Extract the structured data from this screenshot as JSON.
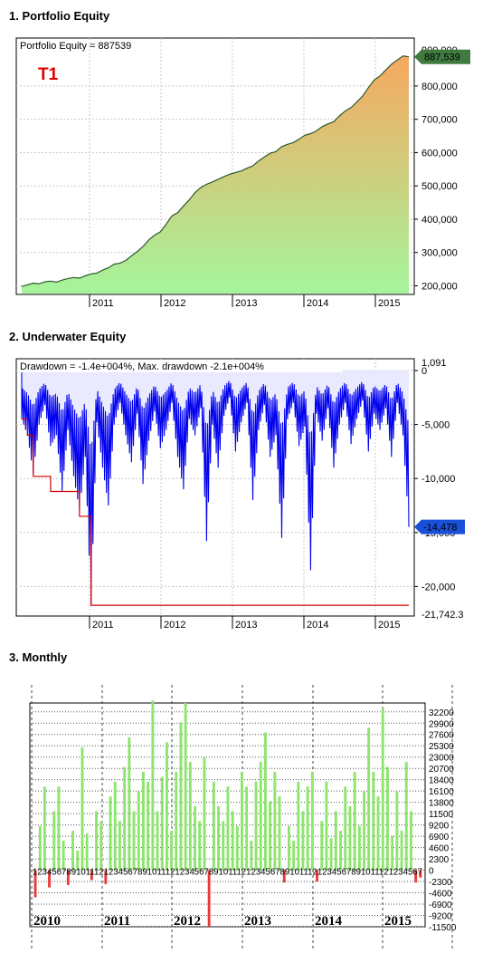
{
  "sections": {
    "s1": "1. Portfolio Equity",
    "s2": "2. Underwater Equity",
    "s3": "3. Monthly"
  },
  "colors": {
    "equity_top": "#f7a860",
    "equity_bottom": "#a4f59c",
    "equity_line": "#2e5a2e",
    "label_green": "#3f7a3f",
    "drawdown_blue": "#0000ee",
    "drawdown_red": "#d40000",
    "bar_pos": "#8ee56e",
    "bar_neg": "#e83a3a"
  },
  "chart_data": [
    {
      "type": "area",
      "title": "Portfolio Equity = 887539",
      "watermark": "T1",
      "series": [
        {
          "name": "Portfolio Equity",
          "values": [
            198000,
            203000,
            208000,
            206000,
            212000,
            214000,
            211000,
            217000,
            222000,
            225000,
            223000,
            230000,
            236000,
            238000,
            247000,
            254000,
            265000,
            268000,
            276000,
            290000,
            303000,
            318000,
            338000,
            352000,
            362000,
            385000,
            410000,
            420000,
            440000,
            458000,
            480000,
            495000,
            505000,
            512000,
            520000,
            528000,
            535000,
            540000,
            545000,
            553000,
            560000,
            575000,
            587000,
            598000,
            603000,
            618000,
            625000,
            630000,
            640000,
            652000,
            657000,
            665000,
            678000,
            686000,
            693000,
            710000,
            725000,
            735000,
            752000,
            770000,
            795000,
            818000,
            830000,
            848000,
            865000,
            878000,
            890000,
            887539
          ]
        }
      ],
      "x_ticks": [
        "2011",
        "2012",
        "2013",
        "2014",
        "2015"
      ],
      "y_ticks": [
        "200,000",
        "300,000",
        "400,000",
        "500,000",
        "600,000",
        "700,000",
        "800,000"
      ],
      "ylim": [
        185000,
        895000
      ],
      "last_value_label": "887,539",
      "top_tick_partial": "900,000"
    },
    {
      "type": "area",
      "title": "Drawdown = -1.4e+004%, Max. drawdown -2.1e+004%",
      "series": [
        {
          "name": "Drawdown",
          "values": [
            -4500,
            -6000,
            -9500,
            -5000,
            -3200,
            -7000,
            -6000,
            -11200,
            -5500,
            -9800,
            -13000,
            -8000,
            -21700,
            -4800,
            -9000,
            -12500,
            -5000,
            -3000,
            -6000,
            -8500,
            -4000,
            -10500,
            -6500,
            -3800,
            -7200,
            -5500,
            -3000,
            -8000,
            -11000,
            -4500,
            -6000,
            -3500,
            -15800,
            -5000,
            -9000,
            -4200,
            -2500,
            -7500,
            -4800,
            -3000,
            -12000,
            -5500,
            -3200,
            -8000,
            -6000,
            -15500,
            -4500,
            -3000,
            -7000,
            -5200,
            -18500,
            -4000,
            -6500,
            -3500,
            -9000,
            -5000,
            -3000,
            -6800,
            -4500,
            -2800,
            -7500,
            -4000,
            -5500,
            -3500,
            -8000,
            -3000,
            -6000,
            -14478
          ]
        },
        {
          "name": "Max drawdown",
          "values": [
            -4500,
            -6000,
            -9800,
            -9800,
            -9800,
            -11200,
            -11200,
            -11200,
            -11200,
            -11200,
            -13500,
            -13500,
            -21742,
            -21742,
            -21742,
            -21742,
            -21742,
            -21742,
            -21742,
            -21742,
            -21742,
            -21742,
            -21742,
            -21742,
            -21742,
            -21742,
            -21742,
            -21742,
            -21742,
            -21742,
            -21742,
            -21742,
            -21742,
            -21742,
            -21742,
            -21742,
            -21742,
            -21742,
            -21742,
            -21742,
            -21742,
            -21742,
            -21742,
            -21742,
            -21742,
            -21742,
            -21742,
            -21742,
            -21742,
            -21742,
            -21742,
            -21742,
            -21742,
            -21742,
            -21742,
            -21742,
            -21742,
            -21742,
            -21742,
            -21742,
            -21742,
            -21742,
            -21742,
            -21742,
            -21742,
            -21742,
            -21742,
            -21742
          ]
        }
      ],
      "x_ticks": [
        "2011",
        "2012",
        "2013",
        "2014",
        "2015"
      ],
      "y_ticks": [
        "0",
        "-5,000",
        "-10,000",
        "-15,000",
        "-20,000"
      ],
      "ylim": [
        -22400,
        1091
      ],
      "top_label": "1,091",
      "last_value_label": "-14,478",
      "min_label": "-21,742.3"
    },
    {
      "type": "bar",
      "month_labels": "1234567891011121234567891011121234567891011121234567891011121234567891011121234567",
      "years": [
        "2010",
        "2011",
        "2012",
        "2013",
        "2014",
        "2015"
      ],
      "y_ticks": [
        "32200",
        "29900",
        "27600",
        "25300",
        "23000",
        "20700",
        "18400",
        "16100",
        "13800",
        "11500",
        "9200",
        "6900",
        "4600",
        "2300",
        "0",
        "-2300",
        "-4600",
        "-6900",
        "-9200",
        "-11500"
      ],
      "ylim": [
        -11500,
        34000
      ],
      "values": [
        -5500,
        9000,
        17000,
        -3500,
        12000,
        17000,
        6000,
        -3000,
        8000,
        4000,
        25000,
        7500,
        -2000,
        12000,
        10000,
        -2800,
        15000,
        18000,
        10000,
        21000,
        27000,
        12000,
        16000,
        20000,
        18000,
        34500,
        12000,
        19000,
        26000,
        8000,
        20000,
        30000,
        34000,
        22000,
        13000,
        10000,
        23000,
        -11500,
        18000,
        13000,
        10000,
        17000,
        12000,
        9000,
        20000,
        17000,
        6000,
        18000,
        22000,
        28000,
        14000,
        20000,
        15000,
        -2500,
        9000,
        6000,
        18000,
        12000,
        17000,
        20000,
        -2300,
        10000,
        18000,
        6500,
        12000,
        8000,
        17000,
        13000,
        20000,
        9000,
        16000,
        29000,
        20000,
        15000,
        33000,
        21000,
        7000,
        16000,
        8000,
        22000,
        12000,
        -2500,
        -1500
      ]
    }
  ]
}
